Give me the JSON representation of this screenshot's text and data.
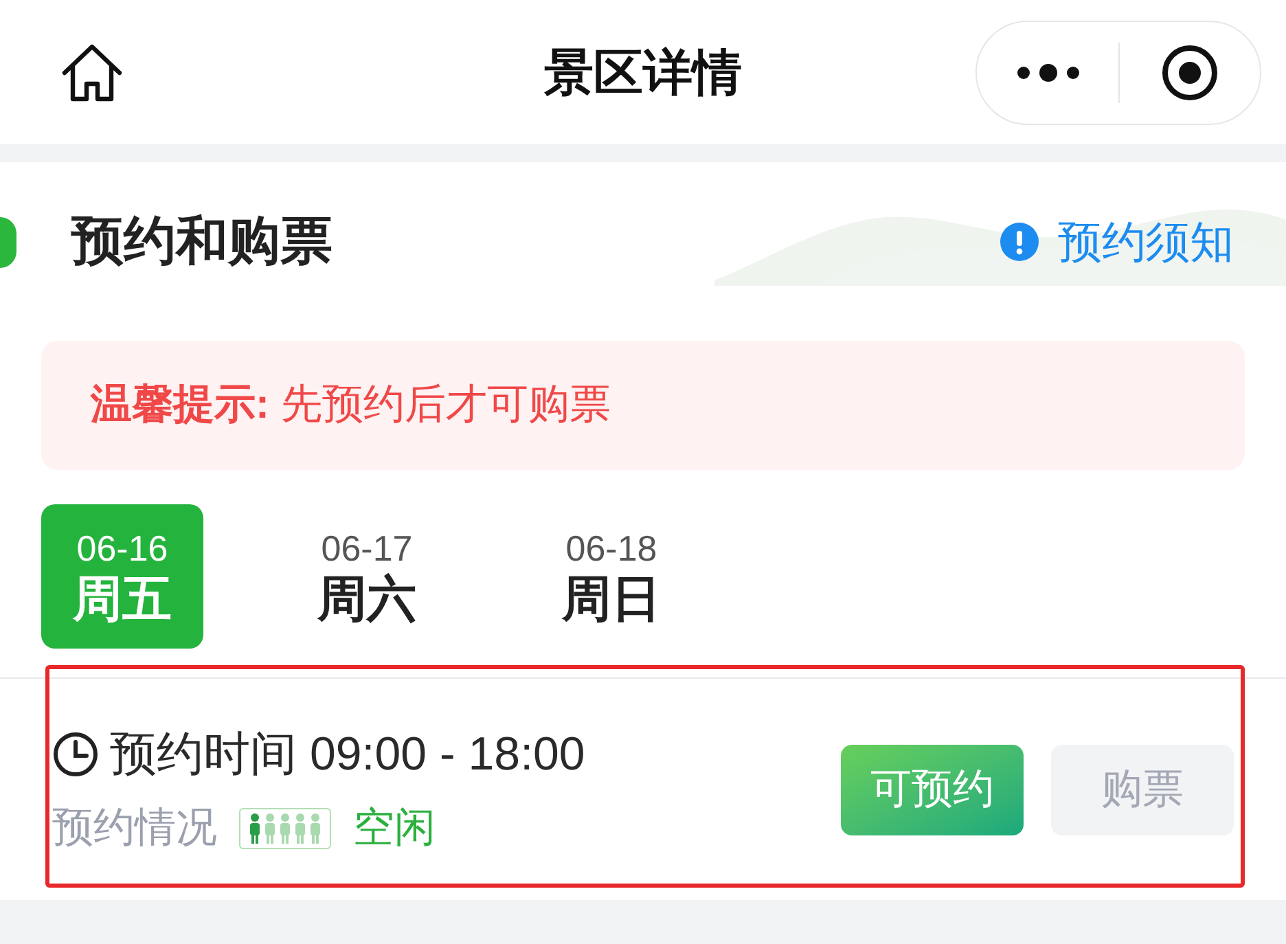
{
  "nav": {
    "title": "景区详情"
  },
  "section": {
    "title": "预约和购票",
    "notice_link": "预约须知"
  },
  "tip": {
    "text": "**温馨提示:** 先预约后才可购票"
  },
  "dates": [
    {
      "date": "06-16",
      "weekday": "周五",
      "selected": true
    },
    {
      "date": "06-17",
      "weekday": "周六",
      "selected": false
    },
    {
      "date": "06-18",
      "weekday": "周日",
      "selected": false
    }
  ],
  "slots": [
    {
      "time_label": "预约时间 09:00 - 18:00",
      "status_label": "预约情况",
      "crowd": {
        "level": 0.2,
        "text": "空闲"
      },
      "reserve_button": {
        "label": "可预约",
        "disabled": false
      },
      "buy_button": {
        "label": "购票",
        "disabled": true
      },
      "highlighted": true
    }
  ]
}
